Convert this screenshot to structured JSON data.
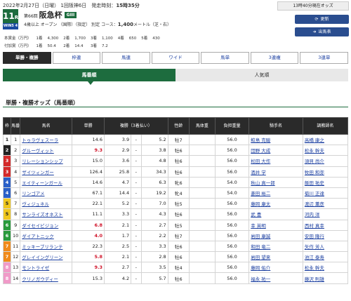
{
  "header": {
    "date": "2022年2月27日（日曜） 1回阪神6日",
    "start_label": "発走時刻：",
    "start_time": "15時35分",
    "race_number": "11",
    "race_suffix": "R",
    "tv_badge": "WIN5 4",
    "race_ordinal": "第66回",
    "race_name": "阪急杯",
    "grade": "GIII",
    "conditions": "4歳以上 オープン （国際）（指定） 別定 コース：",
    "distance": "1,400",
    "course": "メートル（芝・右）",
    "status_text": "13時40分現在オッズ",
    "update_button": "更新",
    "runners_button": "出馬表",
    "prize_rows": [
      [
        "本賞金（万円）",
        "1着",
        "4,300",
        "2着",
        "1,700",
        "3着",
        "1,100",
        "4着",
        "650",
        "5着",
        "430"
      ],
      [
        "付加賞（万円）",
        "1着",
        "50.4",
        "2着",
        "14.4",
        "3着",
        "7.2",
        "",
        "",
        "",
        ""
      ]
    ]
  },
  "tabs": [
    "単勝・複勝",
    "枠連",
    "馬連",
    "ワイド",
    "馬単",
    "3連複",
    "3連単"
  ],
  "subtabs": [
    "馬番順",
    "人気順"
  ],
  "section_title": "単勝・複勝オッズ（馬番順）",
  "columns": [
    "枠",
    "馬番",
    "馬名",
    "単勝",
    "複勝（3着払い）",
    "性齢",
    "馬体重",
    "負担重量",
    "騎手名",
    "調教師名"
  ],
  "frame_colors": {
    "1": "#ffffff",
    "2": "#222222",
    "3": "#d42a2a",
    "4": "#2a5fc8",
    "5": "#f0c81e",
    "6": "#2a9a3c",
    "7": "#f08a1a",
    "8": "#f09ac8"
  },
  "rows": [
    {
      "waku": "1",
      "ban": "1",
      "name": "トゥラヴェスーラ",
      "tan": "14.6",
      "red": false,
      "fmin": "3.9",
      "fmax": "5.2",
      "sex": "牡7",
      "wt": "",
      "kinryo": "56.0",
      "jockey": "鮫島 克駿",
      "trainer": "高橋 康之"
    },
    {
      "waku": "2",
      "ban": "2",
      "name": "グルーヴィット",
      "tan": "9.3",
      "red": true,
      "fmin": "2.9",
      "fmax": "3.8",
      "sex": "牡6",
      "wt": "",
      "kinryo": "56.0",
      "jockey": "団野 大成",
      "trainer": "松永 幹夫"
    },
    {
      "waku": "3",
      "ban": "3",
      "name": "リレーションシップ",
      "tan": "15.0",
      "red": false,
      "fmin": "3.6",
      "fmax": "4.8",
      "sex": "牡6",
      "wt": "",
      "kinryo": "56.0",
      "jockey": "松田 大作",
      "trainer": "須貝 尚介"
    },
    {
      "waku": "3",
      "ban": "4",
      "name": "ザイツィンガー",
      "tan": "126.4",
      "red": false,
      "fmin": "25.8",
      "fmax": "34.3",
      "sex": "牡6",
      "wt": "",
      "kinryo": "56.0",
      "jockey": "酒井 学",
      "trainer": "牧田 和弥"
    },
    {
      "waku": "4",
      "ban": "5",
      "name": "エイティーンガール",
      "tan": "14.6",
      "red": false,
      "fmin": "4.7",
      "fmax": "6.3",
      "sex": "牝6",
      "wt": "",
      "kinryo": "54.0",
      "jockey": "秋山 真一郎",
      "trainer": "飯田 祐史"
    },
    {
      "waku": "4",
      "ban": "6",
      "name": "リンゴアメ",
      "tan": "67.1",
      "red": false,
      "fmin": "14.4",
      "fmax": "19.2",
      "sex": "牝4",
      "wt": "",
      "kinryo": "54.0",
      "jockey": "菱田 裕二",
      "trainer": "菊川 正達"
    },
    {
      "waku": "5",
      "ban": "7",
      "name": "ヴィジュネル",
      "tan": "22.1",
      "red": false,
      "fmin": "5.2",
      "fmax": "7.0",
      "sex": "牡5",
      "wt": "",
      "kinryo": "56.0",
      "jockey": "藤岡 康太",
      "trainer": "渡辺 薫彦"
    },
    {
      "waku": "5",
      "ban": "8",
      "name": "サンライズオネスト",
      "tan": "11.1",
      "red": false,
      "fmin": "3.3",
      "fmax": "4.3",
      "sex": "牡6",
      "wt": "",
      "kinryo": "56.0",
      "jockey": "武 豊",
      "trainer": "河内 洋"
    },
    {
      "waku": "6",
      "ban": "9",
      "name": "ダイセイビジョン",
      "tan": "6.8",
      "red": true,
      "fmin": "2.1",
      "fmax": "2.7",
      "sex": "牡5",
      "wt": "",
      "kinryo": "56.0",
      "jockey": "幸 英明",
      "trainer": "西村 真幸"
    },
    {
      "waku": "6",
      "ban": "10",
      "name": "ダイアトニック",
      "tan": "4.0",
      "red": true,
      "fmin": "1.7",
      "fmax": "2.2",
      "sex": "牡7",
      "wt": "",
      "kinryo": "56.0",
      "jockey": "岩田 康誠",
      "trainer": "安田 隆行"
    },
    {
      "waku": "7",
      "ban": "11",
      "name": "ミッキーブリランテ",
      "tan": "22.3",
      "red": false,
      "fmin": "2.5",
      "fmax": "3.3",
      "sex": "牡6",
      "wt": "",
      "kinryo": "56.0",
      "jockey": "和田 竜二",
      "trainer": "矢作 芳人"
    },
    {
      "waku": "7",
      "ban": "12",
      "name": "グレイイングリーン",
      "tan": "5.8",
      "red": true,
      "fmin": "2.1",
      "fmax": "2.8",
      "sex": "牡6",
      "wt": "",
      "kinryo": "56.0",
      "jockey": "岩田 望来",
      "trainer": "池江 泰寿"
    },
    {
      "waku": "8",
      "ban": "13",
      "name": "モントライゼ",
      "tan": "9.3",
      "red": true,
      "fmin": "2.7",
      "fmax": "3.5",
      "sex": "牡4",
      "wt": "",
      "kinryo": "56.0",
      "jockey": "藤岡 佑介",
      "trainer": "松永 幹夫"
    },
    {
      "waku": "8",
      "ban": "14",
      "name": "クリノガウディー",
      "tan": "15.3",
      "red": false,
      "fmin": "4.2",
      "fmax": "5.7",
      "sex": "牡6",
      "wt": "",
      "kinryo": "56.0",
      "jockey": "福永 祐一",
      "trainer": "藤沢 則雄"
    }
  ]
}
